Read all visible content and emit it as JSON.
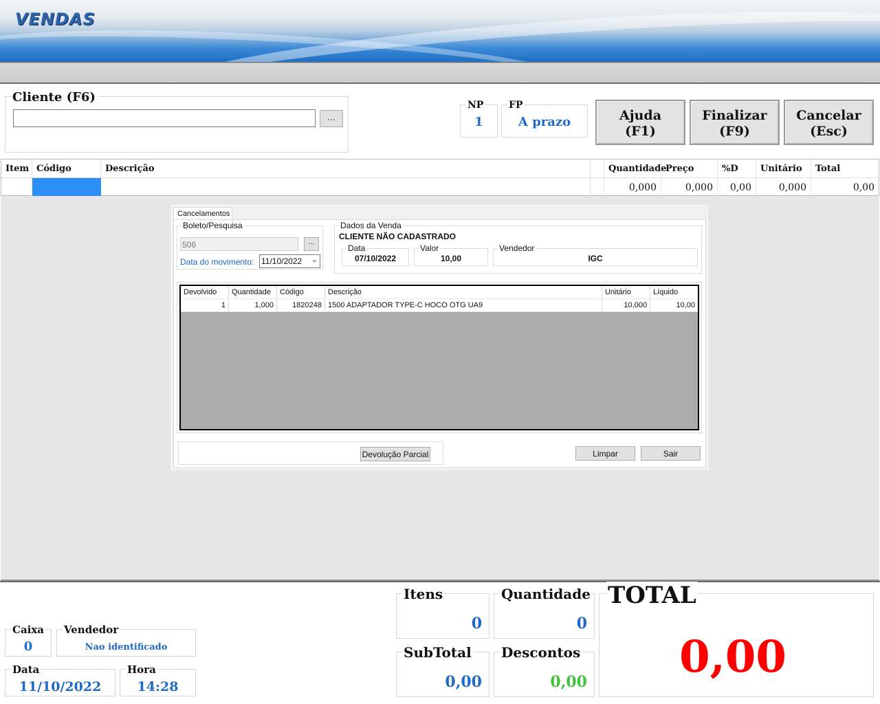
{
  "app": {
    "title": "VENDAS"
  },
  "cliente": {
    "label": "Cliente (F6)",
    "value": "",
    "lookup_label": "..."
  },
  "np": {
    "label": "NP",
    "value": "1"
  },
  "fp": {
    "label": "FP",
    "value": "A prazo"
  },
  "buttons": {
    "ajuda": {
      "line1": "Ajuda",
      "line2": "(F1)"
    },
    "finalizar": {
      "line1": "Finalizar",
      "line2": "(F9)"
    },
    "cancelar": {
      "line1": "Cancelar",
      "line2": "(Esc)"
    }
  },
  "grid": {
    "columns": [
      "Item",
      "Código",
      "Descrição",
      "",
      "Quantidade",
      "Preço",
      "%D",
      "Unitário",
      "Total"
    ],
    "row": {
      "item": "",
      "codigo": "",
      "descricao": "",
      "extra": "",
      "quantidade": "0,000",
      "preco": "0,000",
      "desconto": "0,00",
      "unitario": "0,000",
      "total": "0,00"
    }
  },
  "dialog": {
    "tab": "Cancelamentos",
    "boleto": {
      "title": "Boleto/Pesquisa",
      "value": "506",
      "lookup_label": "...",
      "movimento_label": "Data do movimento:",
      "movimento_value": "11/10/2022"
    },
    "dados": {
      "title": "Dados da Venda",
      "cliente": "CLIENTE NÃO CADASTRADO",
      "data_label": "Data",
      "data_value": "07/10/2022",
      "valor_label": "Valor",
      "valor_value": "10,00",
      "vendedor_label": "Vendedor",
      "vendedor_value": "IGC"
    },
    "items": {
      "columns": [
        "Devolvido",
        "Quantidade",
        "Código",
        "Descrição",
        "Unitário",
        "Líquido"
      ],
      "rows": [
        {
          "devolvido": "1",
          "quantidade": "1,000",
          "codigo": "1820248",
          "descricao": "1500 ADAPTADOR TYPE-C HOCO OTG UA9",
          "unitario": "10,000",
          "liquido": "10,00"
        }
      ]
    },
    "buttons": {
      "devolucao": "Devolução Parcial",
      "limpar": "Limpar",
      "sair": "Sair"
    }
  },
  "footer": {
    "caixa": {
      "label": "Caixa",
      "value": "0"
    },
    "vendedor": {
      "label": "Vendedor",
      "value": "Nao identificado"
    },
    "data": {
      "label": "Data",
      "value": "11/10/2022"
    },
    "hora": {
      "label": "Hora",
      "value": "14:28"
    },
    "itens": {
      "label": "Itens",
      "value": "0"
    },
    "quantidade": {
      "label": "Quantidade",
      "value": "0"
    },
    "subtotal": {
      "label": "SubTotal",
      "value": "0,00"
    },
    "descontos": {
      "label": "Descontos",
      "value": "0,00"
    },
    "total": {
      "label": "TOTAL",
      "value": "0,00"
    }
  },
  "colors": {
    "accent_blue": "#1f6ac4",
    "total_red": "#ff0000",
    "discount_green": "#44c13f",
    "selection": "#2d8ef7"
  }
}
